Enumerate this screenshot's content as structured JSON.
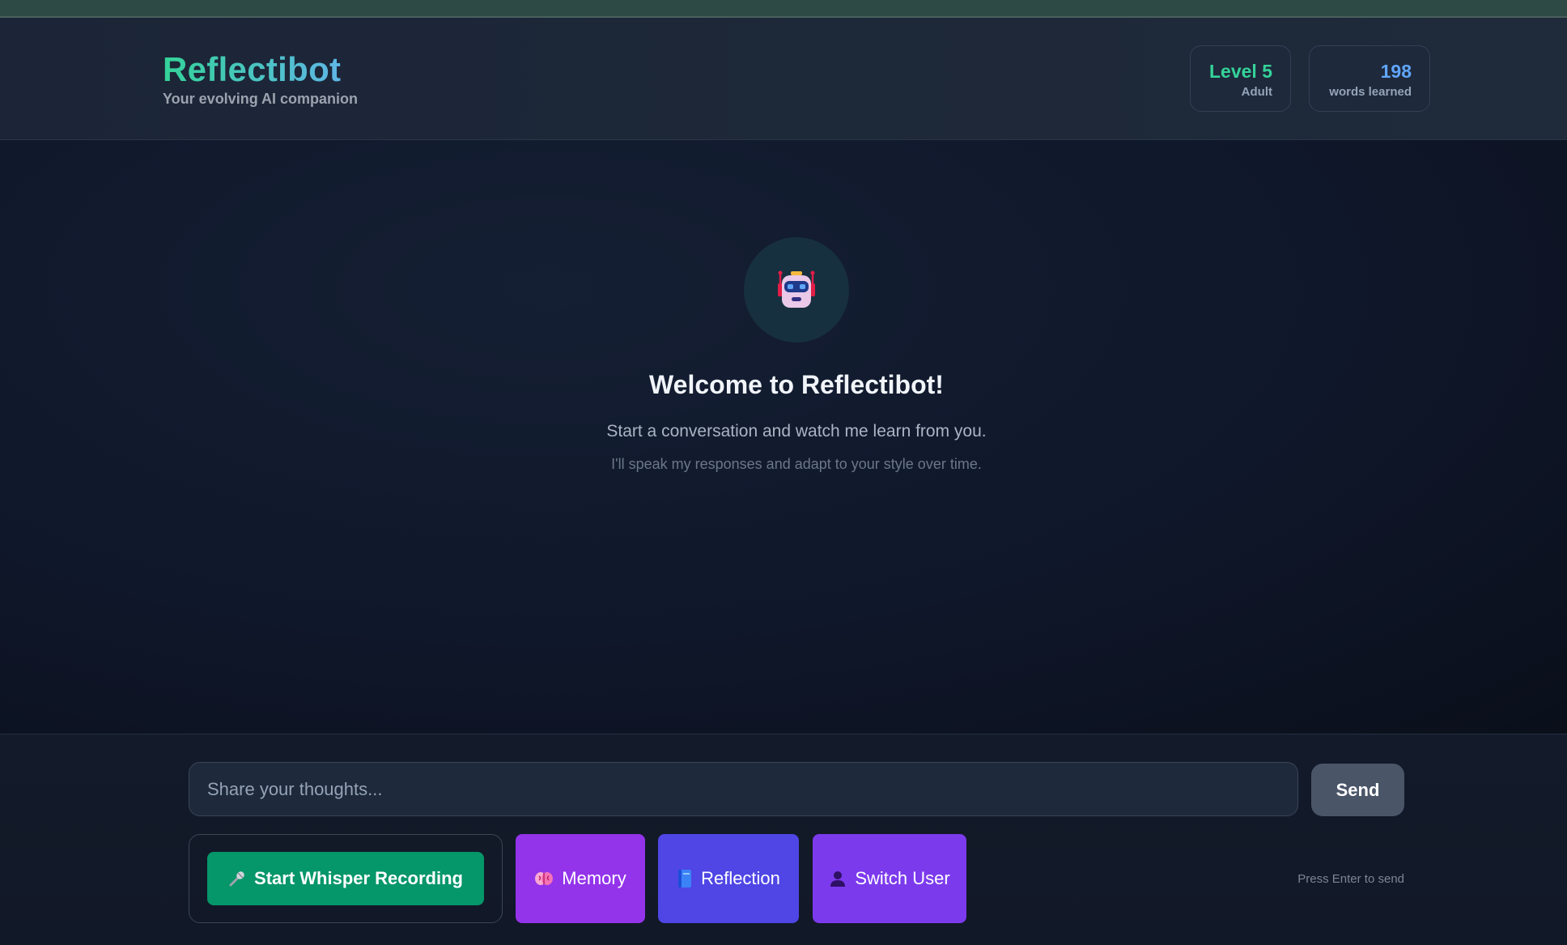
{
  "app": {
    "title": "Reflectibot",
    "subtitle": "Your evolving AI companion"
  },
  "stats": {
    "level_value": "Level 5",
    "level_label": "Adult",
    "words_value": "198",
    "words_label": "words learned"
  },
  "welcome": {
    "avatar_icon": "robot-icon",
    "title": "Welcome to Reflectibot!",
    "line": "Start a conversation and watch me learn from you.",
    "sub": "I'll speak my responses and adapt to your style over time."
  },
  "composer": {
    "placeholder": "Share your thoughts...",
    "send_label": "Send",
    "hint": "Press Enter to send"
  },
  "actions": {
    "record_label": "Start Whisper Recording",
    "record_icon": "microphone-icon",
    "memory_label": "Memory",
    "memory_icon": "brain-icon",
    "reflection_label": "Reflection",
    "reflection_icon": "book-icon",
    "switch_label": "Switch User",
    "switch_icon": "user-silhouette-icon"
  },
  "colors": {
    "accent_green": "#34d399",
    "accent_blue": "#60a5fa",
    "record_green": "#059669",
    "memory_purple": "#9333ea",
    "reflection_indigo": "#4f46e5",
    "switch_violet": "#7c3aed"
  }
}
